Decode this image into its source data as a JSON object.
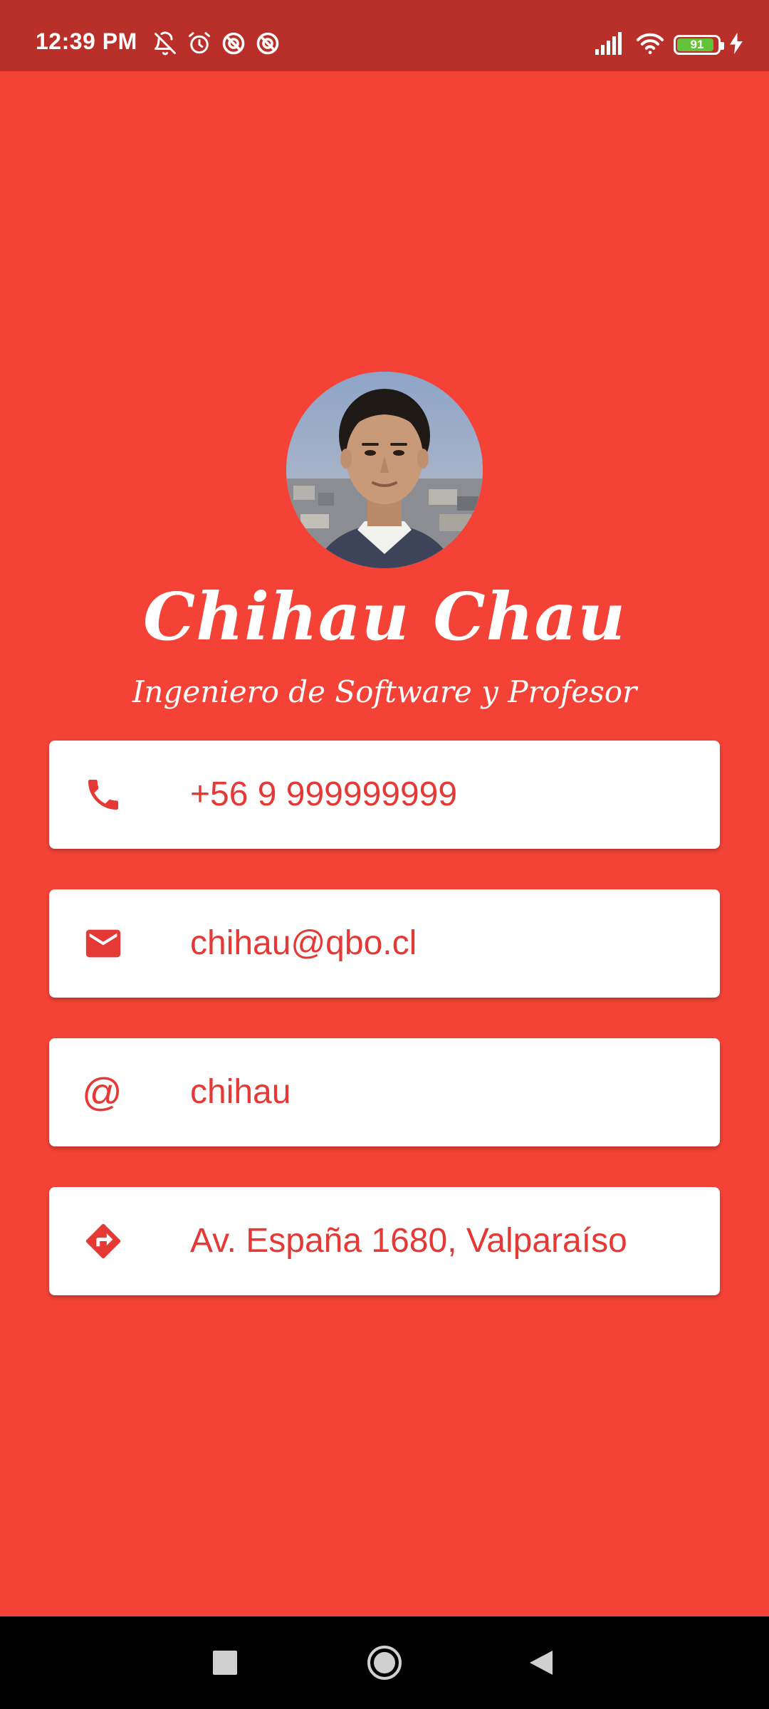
{
  "status_bar": {
    "time": "12:39 PM",
    "left_icons": [
      "bell-off-icon",
      "alarm-icon",
      "data-saver-icon",
      "data-saver-icon"
    ],
    "right_icons": [
      "signal-icon",
      "wifi-icon"
    ],
    "battery_level": "91",
    "battery_fraction": 0.91,
    "charging": true
  },
  "profile": {
    "name": "Chihau Chau",
    "title": "Ingeniero de Software y Profesor"
  },
  "contacts": [
    {
      "icon": "phone-icon",
      "text": "+56 9 999999999"
    },
    {
      "icon": "email-icon",
      "text": "chihau@qbo.cl"
    },
    {
      "icon": "at-icon",
      "text": "chihau",
      "glyph": "@"
    },
    {
      "icon": "directions-icon",
      "text": "Av. España 1680, Valparaíso"
    }
  ],
  "nav": {
    "buttons": [
      "recents-button",
      "home-button",
      "back-button"
    ]
  },
  "colors": {
    "background": "#f44336",
    "status_bar": "#b9302a",
    "accent": "#e53935",
    "card": "#ffffff"
  }
}
